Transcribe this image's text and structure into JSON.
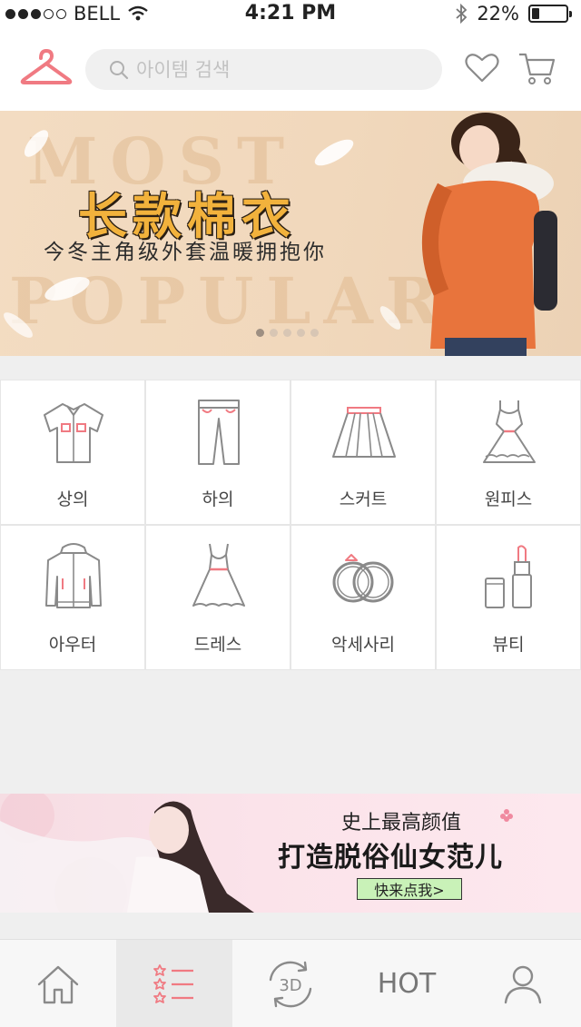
{
  "status_bar": {
    "signal_filled": 3,
    "signal_total": 5,
    "carrier": "BELL",
    "time": "4:21 PM",
    "battery_percent": "22%",
    "battery_level": 0.22
  },
  "header": {
    "logo_icon": "hanger-icon",
    "search_placeholder": "아이템 검색",
    "wishlist_icon": "heart-icon",
    "cart_icon": "cart-icon"
  },
  "banner_top": {
    "title": "长款棉衣",
    "subtitle": "今冬主角级外套温暖拥抱你",
    "background_text_1": "MOST",
    "background_text_2": "POPULAR",
    "pager_count": 5,
    "pager_active_index": 0,
    "accent_color": "#f2b23c"
  },
  "categories": [
    {
      "label": "상의",
      "icon": "shirt-icon"
    },
    {
      "label": "하의",
      "icon": "pants-icon"
    },
    {
      "label": "스커트",
      "icon": "skirt-icon"
    },
    {
      "label": "원피스",
      "icon": "one-piece-dress-icon"
    },
    {
      "label": "아우터",
      "icon": "jacket-icon"
    },
    {
      "label": "드레스",
      "icon": "dress-icon"
    },
    {
      "label": "악세사리",
      "icon": "rings-icon"
    },
    {
      "label": "뷰티",
      "icon": "lipstick-icon"
    }
  ],
  "banner_bottom": {
    "line1": "史上最高颜值",
    "line2": "打造脱俗仙女范儿",
    "button": "快来点我>",
    "button_color": "#c9f2b8"
  },
  "tabbar": {
    "tabs": [
      {
        "icon": "home-icon",
        "active": false
      },
      {
        "icon": "category-list-icon",
        "active": true
      },
      {
        "icon": "rotate-3d-icon",
        "label": "3D",
        "active": false
      },
      {
        "icon": "hot-text",
        "label": "HOT",
        "active": false
      },
      {
        "icon": "user-icon",
        "active": false
      }
    ]
  },
  "colors": {
    "brand_pink": "#f07a82",
    "icon_gray": "#8a8a8a"
  }
}
